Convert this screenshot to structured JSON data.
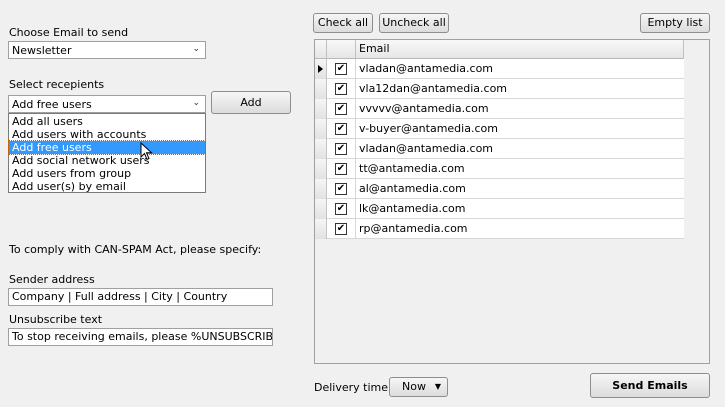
{
  "email_section": {
    "label": "Choose Email to send",
    "selected": "Newsletter"
  },
  "recipients": {
    "label": "Select recepients",
    "selected": "Add free users",
    "add_button": "Add",
    "options": [
      {
        "label": "Add all users",
        "selected": false
      },
      {
        "label": "Add users with accounts",
        "selected": false
      },
      {
        "label": "Add free users",
        "selected": true
      },
      {
        "label": "Add social network users",
        "selected": false
      },
      {
        "label": "Add users from group",
        "selected": false
      },
      {
        "label": "Add user(s) by email",
        "selected": false
      }
    ]
  },
  "compliance": {
    "note": "To comply with CAN-SPAM Act, please specify:",
    "sender_label": "Sender address",
    "sender_value": "Company | Full address | City | Country",
    "unsubscribe_label": "Unsubscribe text",
    "unsubscribe_value": "To stop receiving emails, please %UNSUBSCRIBE%"
  },
  "toolbar": {
    "check_all": "Check all",
    "uncheck_all": "Uncheck all",
    "empty_list": "Empty list"
  },
  "grid": {
    "column_email": "Email",
    "rows": [
      {
        "email": "vladan@antamedia.com",
        "checked": true,
        "current": true
      },
      {
        "email": "vla12dan@antamedia.com",
        "checked": true,
        "current": false
      },
      {
        "email": "vvvvv@antamedia.com",
        "checked": true,
        "current": false
      },
      {
        "email": "v-buyer@antamedia.com",
        "checked": true,
        "current": false
      },
      {
        "email": "vladan@antamedia.com",
        "checked": true,
        "current": false
      },
      {
        "email": "tt@antamedia.com",
        "checked": true,
        "current": false
      },
      {
        "email": "al@antamedia.com",
        "checked": true,
        "current": false
      },
      {
        "email": "lk@antamedia.com",
        "checked": true,
        "current": false
      },
      {
        "email": "rp@antamedia.com",
        "checked": true,
        "current": false
      }
    ]
  },
  "delivery": {
    "label": "Delivery time",
    "selected": "Now"
  },
  "send_button": "Send Emails",
  "icons": {
    "dropdown": "chevron-down-icon",
    "cursor": "mouse-pointer-icon",
    "row_pointer": "triangle-right-icon",
    "check": "checkmark-icon"
  }
}
